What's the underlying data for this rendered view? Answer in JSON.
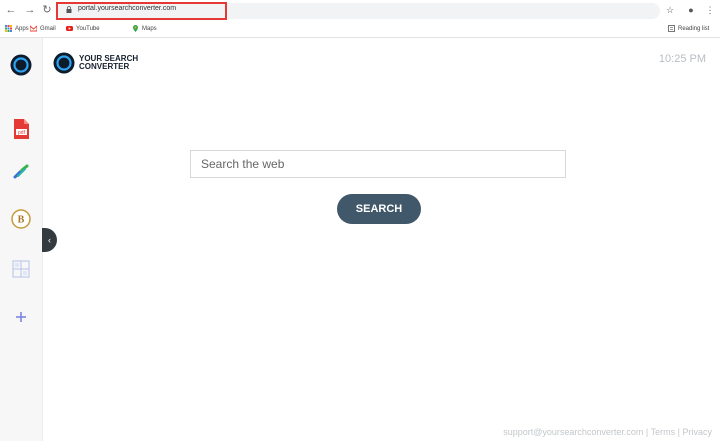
{
  "browser": {
    "url": "portal.yoursearchconverter.com",
    "bookmarks": [
      {
        "label": "Apps",
        "icon": "apps-grid-icon"
      },
      {
        "label": "Gmail",
        "icon": "gmail-icon"
      },
      {
        "label": "YouTube",
        "icon": "youtube-icon"
      },
      {
        "label": "Maps",
        "icon": "maps-pin-icon"
      }
    ],
    "reading_list": "Reading list",
    "highlight_color": "#e53935"
  },
  "sidebar": {
    "items": [
      {
        "name": "logo-ring",
        "icon": "circle-logo-icon"
      },
      {
        "name": "pdf",
        "icon": "pdf-icon",
        "label": "pdf"
      },
      {
        "name": "link",
        "icon": "link-icon"
      },
      {
        "name": "bitcoin",
        "icon": "bitcoin-icon",
        "label": "B"
      },
      {
        "name": "calculator",
        "icon": "calculator-icon"
      },
      {
        "name": "add",
        "icon": "plus-icon"
      }
    ],
    "collapse_glyph": "‹"
  },
  "brand": {
    "line1": "YOUR SEARCH",
    "line2": "CONVERTER"
  },
  "clock": "10:25 PM",
  "search": {
    "placeholder": "Search the web",
    "button_label": "SEARCH",
    "button_color": "#41576a"
  },
  "footer": {
    "email": "support@yoursearchconverter.com",
    "separator": "|",
    "terms": "Terms",
    "privacy": "Privacy"
  }
}
